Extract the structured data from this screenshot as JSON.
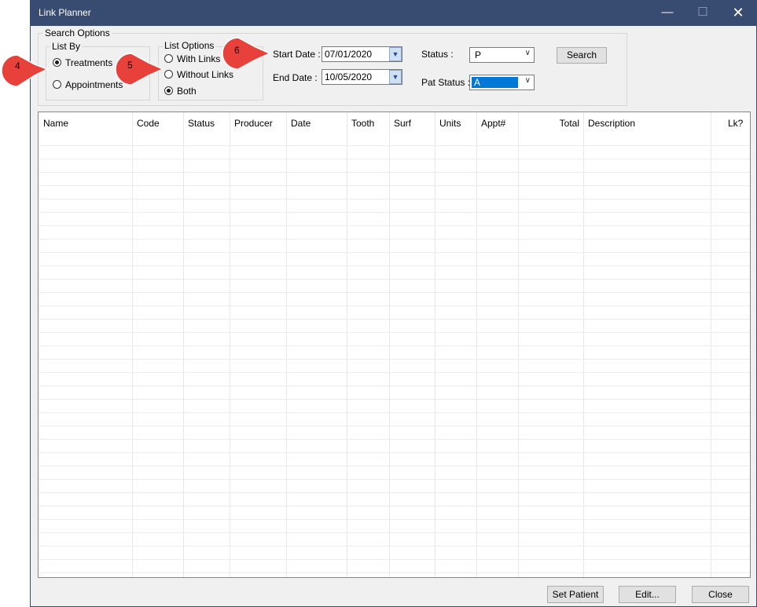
{
  "window": {
    "title": "Link Planner",
    "controls": {
      "minimize": "—",
      "maximize": "☐",
      "close": "✕"
    }
  },
  "search_options": {
    "label": "Search Options",
    "list_by": {
      "label": "List By",
      "options": [
        {
          "label": "Treatments",
          "checked": true
        },
        {
          "label": "Appointments",
          "checked": false
        }
      ]
    },
    "list_options": {
      "label": "List Options",
      "options": [
        {
          "label": "With Links",
          "checked": false
        },
        {
          "label": "Without Links",
          "checked": false
        },
        {
          "label": "Both",
          "checked": true
        }
      ]
    },
    "start_date": {
      "label": "Start Date :",
      "value": "07/01/2020"
    },
    "end_date": {
      "label": "End Date :",
      "value": "10/05/2020"
    },
    "status": {
      "label": "Status :",
      "value": "P"
    },
    "pat_status": {
      "label": "Pat Status :",
      "value": "A"
    },
    "search_button": "Search"
  },
  "grid": {
    "columns": [
      "Name",
      "Code",
      "Status",
      "Producer",
      "Date",
      "Tooth",
      "Surf",
      "Units",
      "Appt#",
      "Total",
      "Description",
      "Lk?"
    ],
    "rows": []
  },
  "footer": {
    "set_patient": "Set Patient",
    "edit": "Edit...",
    "close": "Close"
  },
  "callouts": [
    "4",
    "5",
    "6"
  ],
  "colors": {
    "titlebar": "#384b71",
    "callout": "#e8403a",
    "selection": "#0078d7"
  }
}
